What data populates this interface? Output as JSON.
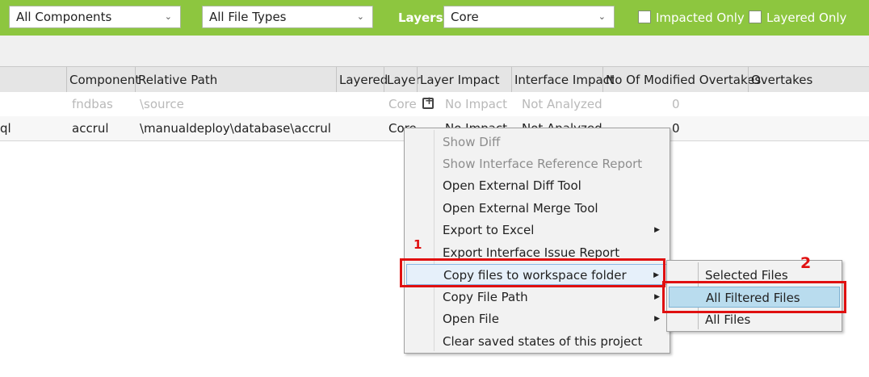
{
  "filters": {
    "components": "All Components",
    "file_types": "All File Types",
    "layers_label": "Layers:",
    "layer": "Core",
    "impacted_only": "Impacted Only",
    "layered_only": "Layered Only"
  },
  "table": {
    "columns": [
      "Component",
      "Relative Path",
      "Layered",
      "Layer",
      "Layer Impact",
      "Interface Impact",
      "No Of Modified Overtakes",
      "Overtakes"
    ],
    "rows": [
      {
        "name": "",
        "component": "fndbas",
        "path": "\\source",
        "layered": "",
        "layer": "Core",
        "layer_impact": "No Impact",
        "interface_impact": "Not Analyzed",
        "modified_overtakes": "0"
      },
      {
        "name": "ql",
        "component": "accrul",
        "path": "\\manualdeploy\\database\\accrul",
        "layered": "",
        "layer": "Core",
        "layer_impact": "No Impact",
        "interface_impact": "Not Analyzed",
        "modified_overtakes": "0"
      }
    ]
  },
  "context_menu": {
    "items": [
      {
        "label": "Show Diff",
        "enabled": false
      },
      {
        "label": "Show Interface Reference Report",
        "enabled": false
      },
      {
        "label": "Open External Diff Tool",
        "enabled": true
      },
      {
        "label": "Open External Merge Tool",
        "enabled": true
      },
      {
        "label": "Export to Excel",
        "enabled": true,
        "submenu": true
      },
      {
        "label": "Export Interface Issue Report",
        "enabled": true
      },
      {
        "label": "Copy files to workspace folder",
        "enabled": true,
        "submenu": true
      },
      {
        "label": "Copy File Path",
        "enabled": true,
        "submenu": true
      },
      {
        "label": "Open File",
        "enabled": true,
        "submenu": true
      },
      {
        "label": "Clear saved states of this project",
        "enabled": true
      }
    ]
  },
  "submenu": {
    "items": [
      {
        "label": "Selected Files"
      },
      {
        "label": "All Filtered Files"
      },
      {
        "label": "All Files"
      }
    ]
  },
  "annotations": {
    "step1": "1",
    "step2": "2",
    "color": "#e01010"
  },
  "colors": {
    "topbar": "#8dc63f",
    "highlight": "#b9dcee"
  }
}
